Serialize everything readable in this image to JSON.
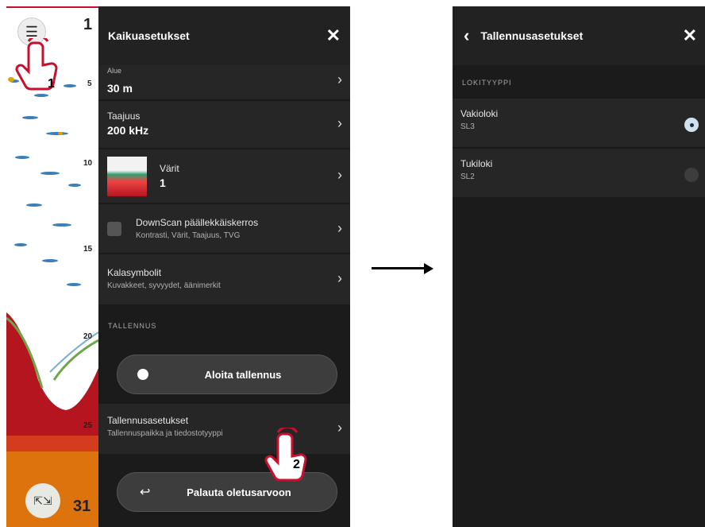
{
  "sonar": {
    "depth_labels": [
      "1",
      "5",
      "10",
      "15",
      "20",
      "25",
      "31"
    ],
    "menu_icon": "hamburger-menu-icon",
    "expand_icon": "expand-icon"
  },
  "step_labels": [
    "1",
    "2"
  ],
  "panel1": {
    "title": "Kaikuasetukset",
    "rows": [
      {
        "label": "Alue",
        "value": "30 m"
      },
      {
        "label": "Taajuus",
        "value": "200 kHz"
      },
      {
        "label": "Värit",
        "value": "1"
      },
      {
        "label": "DownScan päällekkäiskerros",
        "sub": "Kontrasti, Värit, Taajuus, TVG"
      },
      {
        "label": "Kalasymbolit",
        "sub": "Kuvakkeet, syvyydet, äänimerkit"
      }
    ],
    "section_label": "TALLENNUS",
    "record_button": "Aloita tallennus",
    "rec_settings": {
      "label": "Tallennusasetukset",
      "sub": "Tallennuspaikka ja tiedostotyyppi"
    },
    "reset_button": "Palauta oletusarvoon"
  },
  "panel2": {
    "title": "Tallennusasetukset",
    "section_label": "LOKITYYPPI",
    "options": [
      {
        "label": "Vakioloki",
        "sub": "SL3",
        "selected": true
      },
      {
        "label": "Tukiloki",
        "sub": "SL2",
        "selected": false
      }
    ]
  },
  "colors": {
    "panel_bg": "#1b1b1b",
    "row_bg": "#262626",
    "sonar_red": "#b4151f"
  }
}
